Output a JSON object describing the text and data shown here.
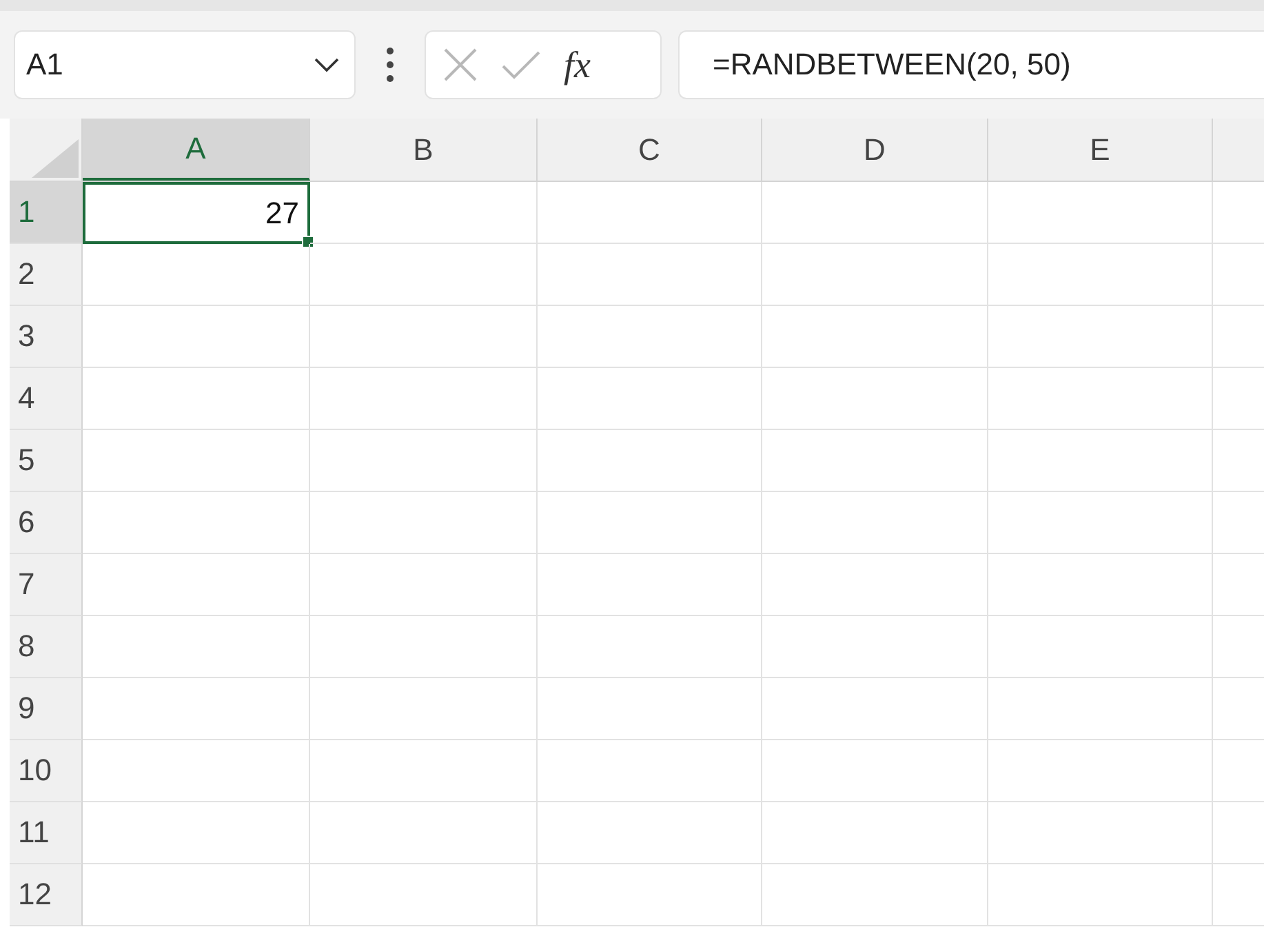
{
  "name_box": {
    "value": "A1"
  },
  "function_label": "fx",
  "formula_bar": {
    "value": "=RANDBETWEEN(20, 50)"
  },
  "columns": [
    {
      "label": "A",
      "selected": true
    },
    {
      "label": "B",
      "selected": false
    },
    {
      "label": "C",
      "selected": false
    },
    {
      "label": "D",
      "selected": false
    },
    {
      "label": "E",
      "selected": false
    }
  ],
  "rows": [
    {
      "label": "1",
      "selected": true,
      "cells": [
        {
          "value": "27",
          "selected": true
        }
      ]
    },
    {
      "label": "2",
      "selected": false
    },
    {
      "label": "3",
      "selected": false
    },
    {
      "label": "4",
      "selected": false
    },
    {
      "label": "5",
      "selected": false
    },
    {
      "label": "6",
      "selected": false
    },
    {
      "label": "7",
      "selected": false
    },
    {
      "label": "8",
      "selected": false
    },
    {
      "label": "9",
      "selected": false
    },
    {
      "label": "10",
      "selected": false
    },
    {
      "label": "11",
      "selected": false
    },
    {
      "label": "12",
      "selected": false
    }
  ]
}
